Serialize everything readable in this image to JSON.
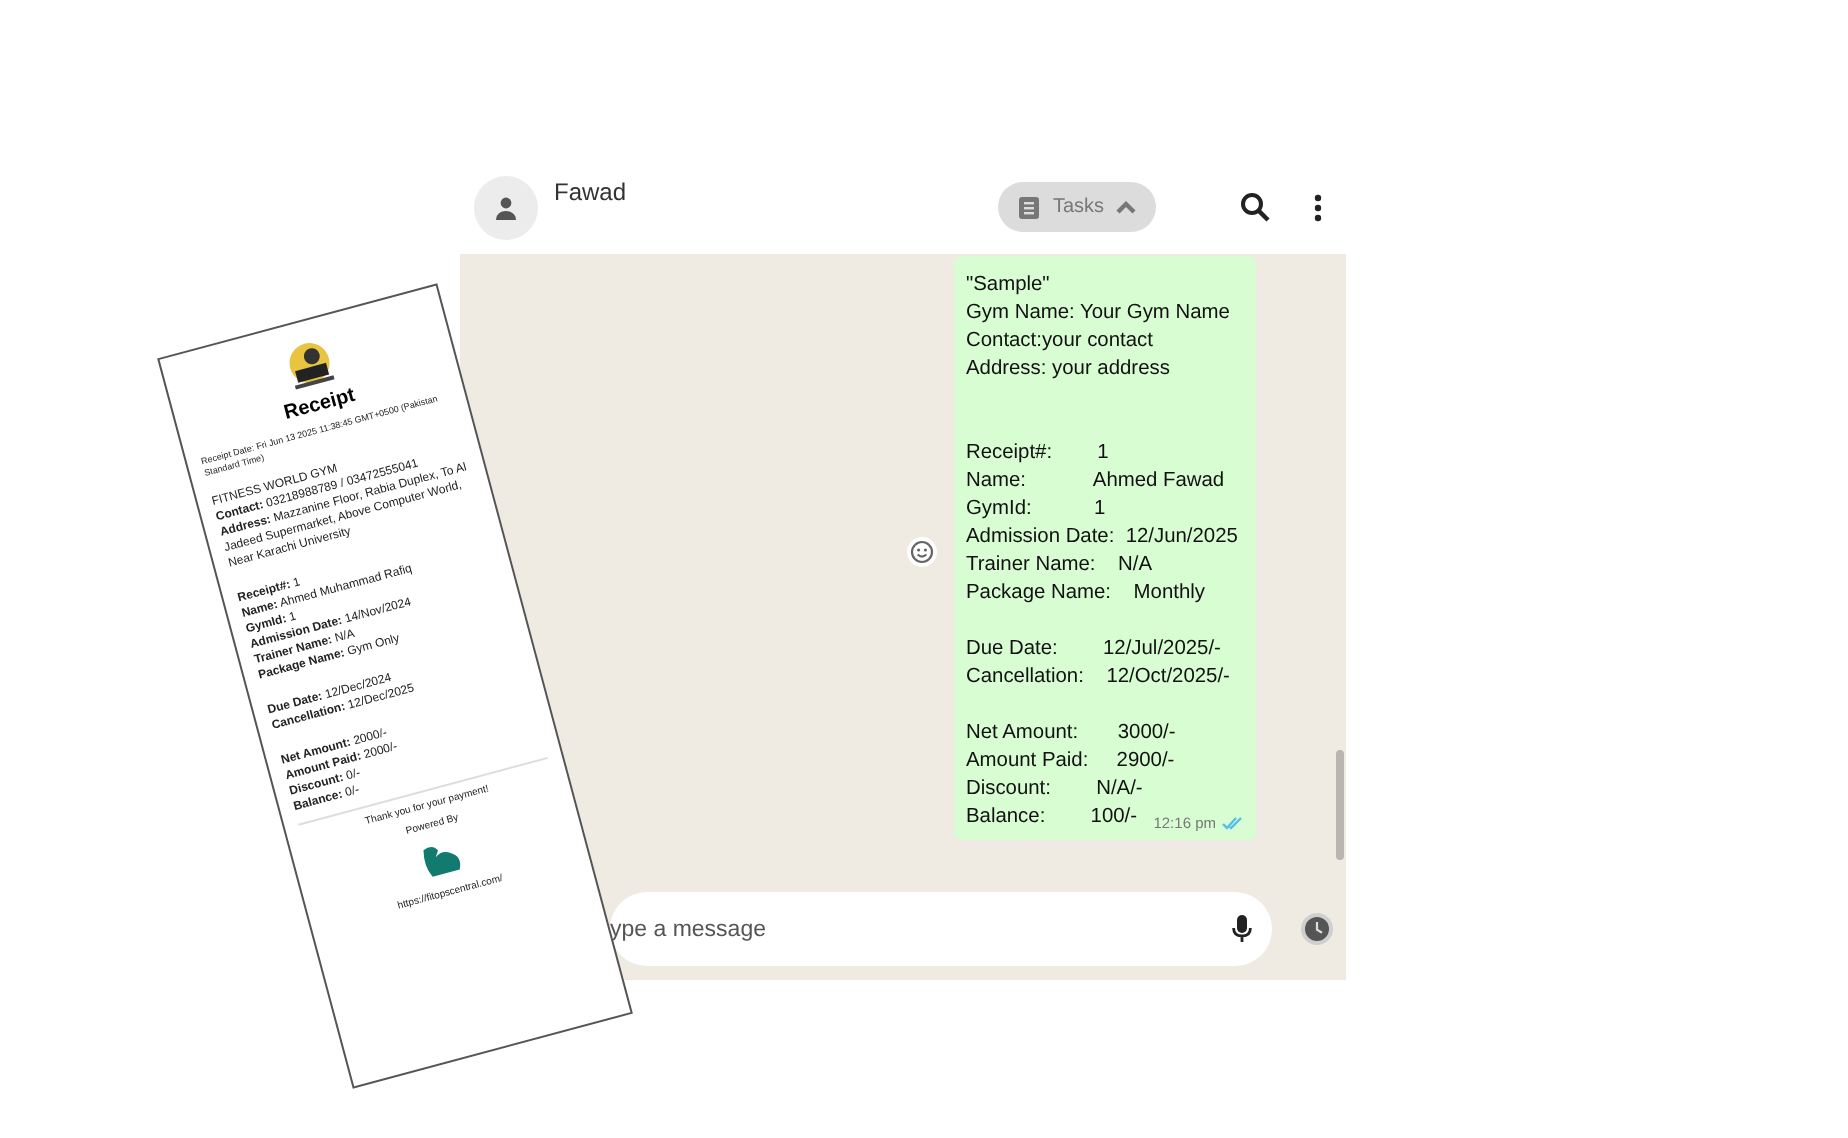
{
  "chat": {
    "contact_name": "Fawad",
    "tasks_button": "Tasks",
    "message": {
      "sections": [
        [
          "\"Sample\"",
          "Gym Name: Your Gym Name",
          "Contact:your contact",
          "Address: your address"
        ],
        [
          "Receipt#:        1",
          "Name:            Ahmed Fawad",
          "GymId:           1",
          "Admission Date:  12/Jun/2025",
          "Trainer Name:    N/A",
          "Package Name:    Monthly"
        ],
        [
          "Due Date:        12/Jul/2025/-",
          "Cancellation:    12/Oct/2025/-"
        ],
        [
          "Net Amount:       3000/-",
          "Amount Paid:     2900/-",
          "Discount:        N/A/-",
          "Balance:        100/-"
        ]
      ],
      "time": "12:16 pm",
      "read": true
    },
    "input": {
      "placeholder": "ype a message"
    }
  },
  "receipt": {
    "title": "Receipt",
    "date": "Receipt Date: Fri Jun 13 2025 11:38:45 GMT+0500 (Pakistan Standard Time)",
    "gym_name": "FITNESS WORLD GYM",
    "header_fields": [
      {
        "label": "Contact:",
        "value": "03218988789 / 03472555041"
      },
      {
        "label": "Address:",
        "value": "Mazzanine Floor, Rabia Duplex, To Al Jadeed Supermarket, Above Computer World, Near Karachi University"
      }
    ],
    "field_groups": [
      [
        {
          "label": "Receipt#:",
          "value": "1"
        },
        {
          "label": "Name:",
          "value": "Ahmed Muhammad Rafiq"
        },
        {
          "label": "GymId:",
          "value": "1"
        },
        {
          "label": "Admission Date:",
          "value": "14/Nov/2024"
        },
        {
          "label": "Trainer Name:",
          "value": "N/A"
        },
        {
          "label": "Package Name:",
          "value": "Gym Only"
        }
      ],
      [
        {
          "label": "Due Date:",
          "value": "12/Dec/2024"
        },
        {
          "label": "Cancellation:",
          "value": "12/Dec/2025"
        }
      ],
      [
        {
          "label": "Net Amount:",
          "value": "2000/-"
        },
        {
          "label": "Amount Paid:",
          "value": "2000/-"
        },
        {
          "label": "Discount:",
          "value": "0/-"
        },
        {
          "label": "Balance:",
          "value": "0/-"
        }
      ]
    ],
    "thanks": "Thank you for your payment!",
    "powered_by": "Powered By",
    "url": "https://fitopscentral.com/"
  }
}
